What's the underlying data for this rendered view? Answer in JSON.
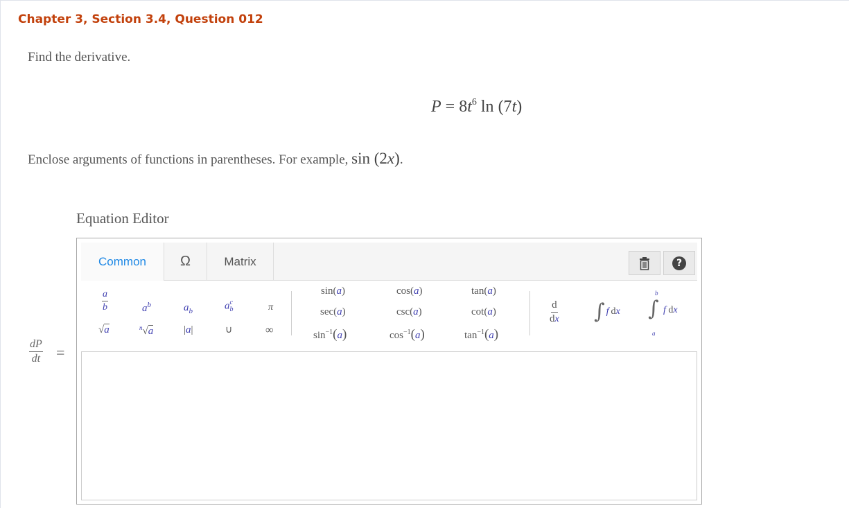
{
  "question": {
    "title": "Chapter 3, Section 3.4, Question 012",
    "prompt": "Find the derivative.",
    "formula": {
      "lhs": "P",
      "eq": "=",
      "coef": "8",
      "var": "t",
      "exp": "6",
      "fn": "ln",
      "arg_open": "(7",
      "arg_var": "t",
      "arg_close": ")"
    },
    "hint": "Enclose arguments of functions in parentheses. For example,",
    "hint_example": {
      "fn": "sin",
      "open": "(2",
      "var": "x",
      "close": ")",
      "period": "."
    }
  },
  "editor": {
    "label": "Equation Editor",
    "tabs": {
      "common": "Common",
      "symbols": "Ω",
      "matrix": "Matrix"
    },
    "toolbar_icons": {
      "trash": "trash-icon",
      "help": "help-icon",
      "help_glyph": "?"
    },
    "palette": {
      "fraction": {
        "num": "a",
        "den": "b"
      },
      "power": {
        "base": "a",
        "exp": "b"
      },
      "subscript": {
        "base": "a",
        "sub": "b"
      },
      "subsup": {
        "base": "a",
        "sup": "c",
        "sub": "b"
      },
      "pi": "π",
      "sqrt": {
        "sign": "√",
        "arg": "a"
      },
      "nroot": {
        "index": "n",
        "sign": "√",
        "arg": "a"
      },
      "abs": {
        "open": "|",
        "arg": "a",
        "close": "|"
      },
      "union": "∪",
      "infinity": "∞",
      "trig": [
        [
          "sin",
          "cos",
          "tan"
        ],
        [
          "sec",
          "csc",
          "cot"
        ],
        [
          "sin",
          "cos",
          "tan"
        ]
      ],
      "trig_arg": "a",
      "inverse_exp": "−1",
      "derivative": {
        "num": "d",
        "den": "d",
        "den_var": "x"
      },
      "integral": {
        "sign": "∫",
        "f": "f",
        "d": "d",
        "x": "x"
      },
      "def_integral": {
        "upper": "b",
        "lower": "a"
      }
    },
    "answer_lhs": {
      "num": "dP",
      "den": "dt",
      "eq": "="
    },
    "colors": {
      "title": "#c2410c",
      "tab_active": "#1e88e5",
      "variable": "#3f3fb0"
    }
  }
}
